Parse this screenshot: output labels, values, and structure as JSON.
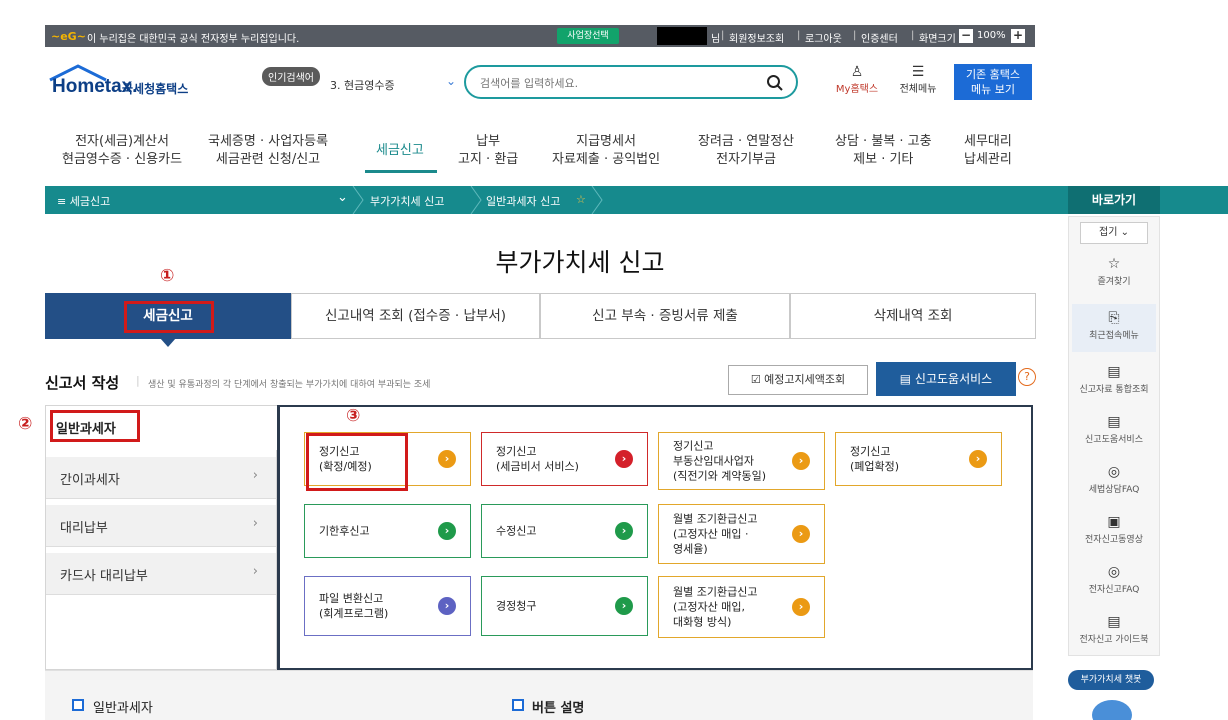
{
  "topbar": {
    "gov_notice": "이 누리집은 대한민국 공식 전자정부 누리집입니다.",
    "biz_select": "사업장선택",
    "user_suffix": "님",
    "links": [
      "회원정보조회",
      "로그아웃",
      "인증센터",
      "화면크기"
    ],
    "zoom": "100%",
    "zoom_minus": "−",
    "zoom_plus": "+"
  },
  "header": {
    "logo": "Hometax.",
    "logo_sub": "국세청홈택스",
    "popular_badge": "인기검색어",
    "popular_term": "3. 현금영수증",
    "search_placeholder": "검색어를 입력하세요.",
    "my_hometax": "My홈택스",
    "all_menu": "전체메뉴",
    "old_menu_line1": "기존 홈택스",
    "old_menu_line2": "메뉴 보기"
  },
  "gnb": [
    {
      "l1": "전자(세금)계산서",
      "l2": "현금영수증 · 신용카드"
    },
    {
      "l1": "국세증명 · 사업자등록",
      "l2": "세금관련 신청/신고"
    },
    {
      "l1": "세금신고",
      "l2": ""
    },
    {
      "l1": "납부",
      "l2": "고지 · 환급"
    },
    {
      "l1": "지급명세서",
      "l2": "자료제출 · 공익법인"
    },
    {
      "l1": "장려금 · 연말정산",
      "l2": "전자기부금"
    },
    {
      "l1": "상담 · 불복 · 고충",
      "l2": "제보 · 기타"
    },
    {
      "l1": "세무대리",
      "l2": "납세관리"
    }
  ],
  "breadcrumb": {
    "menu": "≡ 세금신고",
    "chevron": "⌄",
    "level2": "부가가치세 신고",
    "level3": "일반과세자 신고",
    "star": "☆"
  },
  "page_title": "부가가치세 신고",
  "annotations": [
    "①",
    "②",
    "③"
  ],
  "tabs": [
    "세금신고",
    "신고내역 조회 (접수증 · 납부서)",
    "신고 부속 · 증빙서류 제출",
    "삭제내역 조회"
  ],
  "section": {
    "title": "신고서 작성",
    "desc": "생산 및 유통과정의 각 단계에서 창출되는 부가가치에 대하여 부과되는 조세",
    "btn_notice": "☑ 예정고지세액조회",
    "btn_help": "▤ 신고도움서비스",
    "help_q": "?"
  },
  "left_menu": {
    "active": "일반과세자",
    "items": [
      "간이과세자",
      "대리납부",
      "카드사 대리납부"
    ],
    "arrow": "›"
  },
  "cards": [
    {
      "line1": "정기신고",
      "line2": "(확정/예정)",
      "line3": "",
      "color": "orange"
    },
    {
      "line1": "정기신고",
      "line2": "(세금비서 서비스)",
      "line3": "",
      "color": "red"
    },
    {
      "line1": "정기신고",
      "line2": "부동산임대사업자",
      "line3": "(직전기와 계약동일)",
      "color": "orange"
    },
    {
      "line1": "정기신고",
      "line2": "(폐업확정)",
      "line3": "",
      "color": "orange"
    },
    {
      "line1": "기한후신고",
      "line2": "",
      "line3": "",
      "color": "green"
    },
    {
      "line1": "수정신고",
      "line2": "",
      "line3": "",
      "color": "green"
    },
    {
      "line1": "월별 조기환급신고",
      "line2": "(고정자산 매입 ·",
      "line3": "영세율)",
      "color": "orange"
    },
    {
      "line1": "파일 변환신고",
      "line2": "(회계프로그램)",
      "line3": "",
      "color": "purple"
    },
    {
      "line1": "경정청구",
      "line2": "",
      "line3": "",
      "color": "green"
    },
    {
      "line1": "월별 조기환급신고",
      "line2": "(고정자산 매입,",
      "line3": "대화형 방식)",
      "color": "orange"
    }
  ],
  "bottom": {
    "left_title": "일반과세자",
    "right_title": "버튼 설명"
  },
  "quick_menu": {
    "title": "바로가기",
    "fold": "접기 ⌄",
    "items": [
      "즐겨찾기",
      "최근접속메뉴",
      "신고자료 통합조회",
      "신고도움서비스",
      "세법상담FAQ",
      "전자신고동영상",
      "전자신고FAQ",
      "전자신고 가이드북"
    ],
    "chatbot": "부가가치세 챗봇"
  }
}
